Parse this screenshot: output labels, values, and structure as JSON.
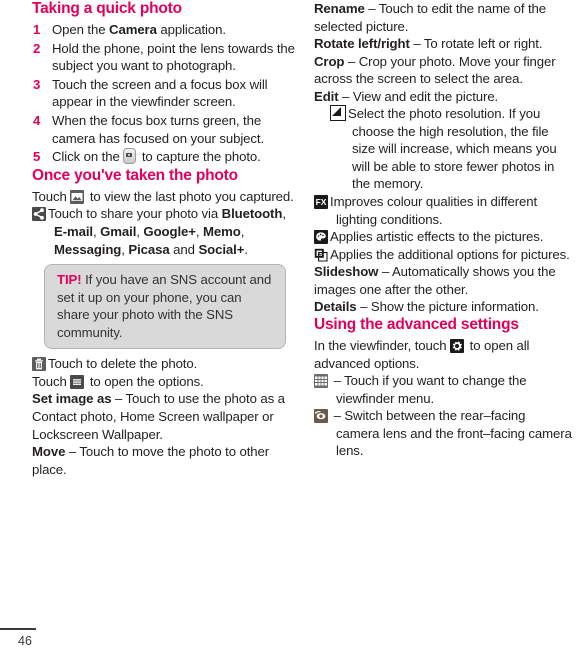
{
  "page": {
    "number": "46"
  },
  "left_column": {
    "section1": {
      "heading": "Taking a quick photo",
      "steps": [
        {
          "num": "1",
          "pre": "Open the ",
          "bold": "Camera",
          "post": " application."
        },
        {
          "num": "2",
          "pre": "Hold the phone, point the lens towards the subject you want to photograph.",
          "bold": "",
          "post": ""
        },
        {
          "num": "3",
          "pre": "Touch the screen and a focus box will appear in the viewfinder screen.",
          "bold": "",
          "post": ""
        },
        {
          "num": "4",
          "pre": "When the focus box turns green, the camera has focused on your subject.",
          "bold": "",
          "post": ""
        },
        {
          "num": "5",
          "pre": "Click on the ",
          "bold": "",
          "post": " to capture the photo.",
          "icon": "shutter-button-icon"
        }
      ]
    },
    "section2": {
      "heading": "Once you've taken the photo",
      "view_last_pre": "Touch ",
      "view_last_icon": "gallery-icon",
      "view_last_post": " to view the last photo you captured.",
      "share_icon": "share-icon",
      "share_text_pre": "Touch to share your photo via ",
      "share_apps": [
        "Bluetooth",
        "E-mail",
        "Gmail",
        "Google+",
        "Memo",
        "Messaging",
        "Picasa",
        "Social+"
      ],
      "share_text_post": ".",
      "tip": {
        "label": "TIP!",
        "text": "If you have an SNS account and set it up on your phone, you can share your photo with the SNS community."
      },
      "delete_icon": "trash-icon",
      "delete_text": "Touch to delete the photo.",
      "menu_pre": "Touch ",
      "menu_icon": "menu-icon",
      "menu_post": " to open the options.",
      "options": [
        {
          "term": "Set image as",
          "desc": " – Touch to use the photo as a Contact photo, Home Screen wallpaper or Lockscreen Wallpaper."
        },
        {
          "term": "Move",
          "desc": " – Touch to move the photo to other place."
        }
      ]
    }
  },
  "right_column": {
    "options_continued": [
      {
        "term": "Rename",
        "desc": " – Touch to edit the name of the selected picture."
      },
      {
        "term": "Rotate left/right",
        "desc": " – To rotate left or right."
      },
      {
        "term": "Crop",
        "desc": " – Crop your photo. Move your finger across the screen to select the area."
      },
      {
        "term": "Edit",
        "desc": " – View and edit the picture."
      }
    ],
    "edit_icons": [
      {
        "icon": "resolution-icon",
        "text": "Select the photo resolution. If you choose the high resolution, the file size will increase, which means you will be able to store fewer photos in the memory.",
        "indent": "deep"
      },
      {
        "icon": "fx-icon",
        "text": "Improves colour qualities in different lighting conditions.",
        "indent": "shallow"
      },
      {
        "icon": "effects-icon",
        "text": "Applies artistic effects to the pictures.",
        "indent": "shallow"
      },
      {
        "icon": "additional-options-icon",
        "text": "Applies the additional options for pictures.",
        "indent": "shallow"
      }
    ],
    "options_tail": [
      {
        "term": "Slideshow",
        "desc": " – Automatically shows you the images one after the other."
      },
      {
        "term": "Details",
        "desc": " – Show the picture information."
      }
    ],
    "section3": {
      "heading": "Using the advanced settings",
      "intro_pre": "In the viewfinder, touch ",
      "intro_icon": "gear-icon",
      "intro_post": " to open all advanced options.",
      "items": [
        {
          "icon": "viewfinder-grid-icon",
          "text": " – Touch if you want to change the viewfinder menu."
        },
        {
          "icon": "camera-swap-icon",
          "text": " – Switch between the rear–facing camera lens and the front–facing camera lens."
        }
      ]
    }
  },
  "colors": {
    "accent_pink": "#e4005a",
    "body_text": "#231f20",
    "tip_bg": "#d9d9d9"
  }
}
